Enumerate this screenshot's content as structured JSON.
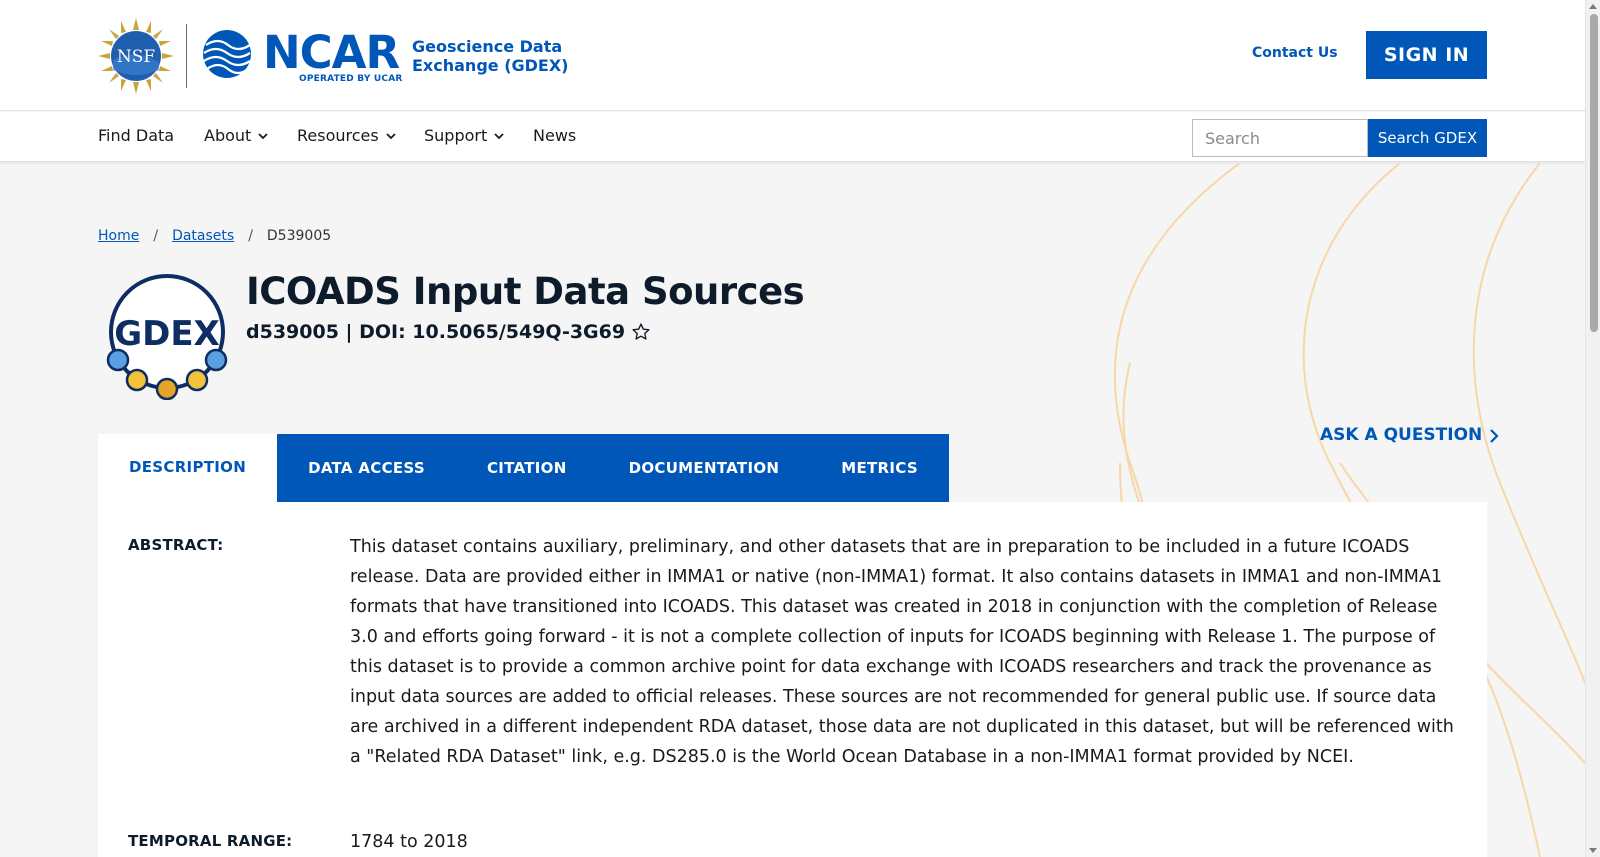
{
  "header": {
    "nsf_logo_text": "NSF",
    "ncar_word": "NCAR",
    "ncar_sub": "OPERATED BY UCAR",
    "site_name_line1": "Geoscience Data",
    "site_name_line2": "Exchange (GDEX)",
    "contact_label": "Contact Us",
    "signin_label": "SIGN IN"
  },
  "nav": {
    "items": [
      {
        "label": "Find Data",
        "has_dropdown": false
      },
      {
        "label": "About",
        "has_dropdown": true
      },
      {
        "label": "Resources",
        "has_dropdown": true
      },
      {
        "label": "Support",
        "has_dropdown": true
      },
      {
        "label": "News",
        "has_dropdown": false
      }
    ],
    "search_placeholder": "Search",
    "search_button": "Search GDEX"
  },
  "breadcrumb": [
    {
      "label": "Home",
      "link": true
    },
    {
      "label": "Datasets",
      "link": true
    },
    {
      "label": "D539005",
      "link": false
    }
  ],
  "dataset": {
    "logo_text": "GDEX",
    "title": "ICOADS Input Data Sources",
    "subtitle": "d539005 | DOI: 10.5065/549Q-3G69"
  },
  "ask_label": "ASK A QUESTION",
  "tabs": [
    {
      "label": "DESCRIPTION",
      "active": true
    },
    {
      "label": "DATA ACCESS",
      "active": false
    },
    {
      "label": "CITATION",
      "active": false
    },
    {
      "label": "DOCUMENTATION",
      "active": false
    },
    {
      "label": "METRICS",
      "active": false
    }
  ],
  "description": {
    "abstract_label": "ABSTRACT:",
    "abstract_text": "This dataset contains auxiliary, preliminary, and other datasets that are in preparation to be included in a future ICOADS release. Data are provided either in IMMA1 or native (non-IMMA1) format. It also contains datasets in IMMA1 and non-IMMA1 formats that have transitioned into ICOADS. This dataset was created in 2018 in conjunction with the completion of Release 3.0 and efforts going forward - it is not a complete collection of inputs for ICOADS beginning with Release 1. The purpose of this dataset is to provide a common archive point for data exchange with ICOADS researchers and track the provenance as input data sources are added to official releases. These sources are not recommended for general public use. If source data are archived in a different independent RDA dataset, those data are not duplicated in this dataset, but will be referenced with a \"Related RDA Dataset\" link, e.g. DS285.0 is the World Ocean Database in a non-IMMA1 format provided by NCEI.",
    "temporal_label": "TEMPORAL RANGE:",
    "temporal_value": "1784 to 2018"
  },
  "colors": {
    "brand_blue": "#0057b8",
    "title_navy": "#0d1b2a",
    "deco_orange": "#f6d7a7"
  }
}
